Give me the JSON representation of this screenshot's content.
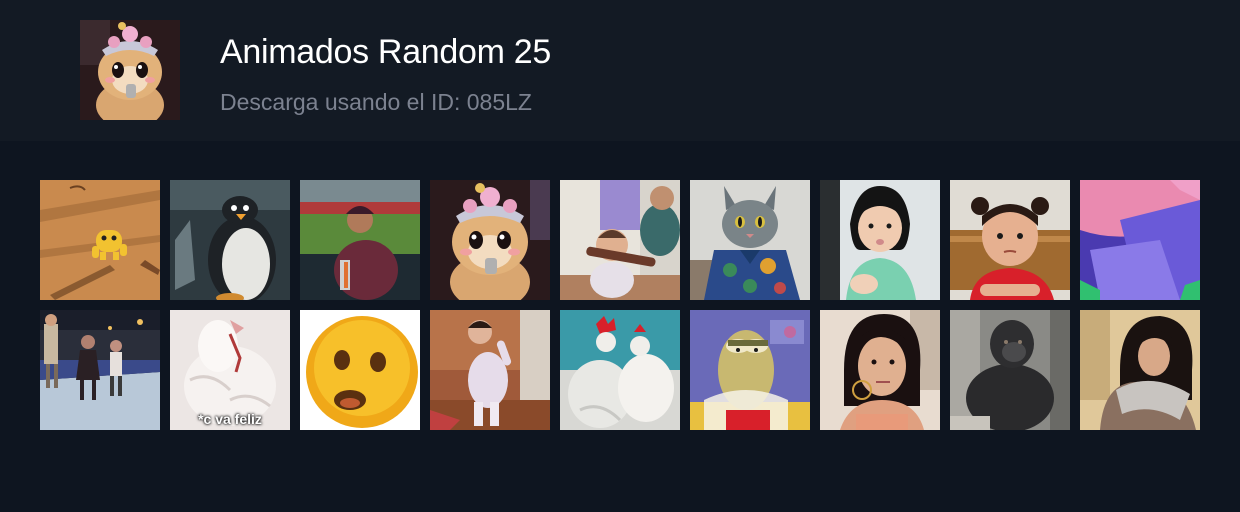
{
  "pack": {
    "title": "Animados Random 25",
    "subtitle": "Descarga usando el ID: 085LZ",
    "avatar_icon": "hamster-mascot-sticker"
  },
  "stickers": [
    {
      "icon": "cartoon-dog-jumping"
    },
    {
      "icon": "penguin"
    },
    {
      "icon": "baseball-player"
    },
    {
      "icon": "hamster-mascot"
    },
    {
      "icon": "baby-with-toy"
    },
    {
      "icon": "cat-in-hawaiian-shirt"
    },
    {
      "icon": "little-girl"
    },
    {
      "icon": "toddler-girl-red-shirt"
    },
    {
      "icon": "abstract-colors"
    },
    {
      "icon": "people-skating"
    },
    {
      "icon": "white-chicken",
      "caption": "*c va feliz"
    },
    {
      "icon": "emoji-face-surprised"
    },
    {
      "icon": "toddler-dancing"
    },
    {
      "icon": "roosters"
    },
    {
      "icon": "cartoon-fish"
    },
    {
      "icon": "woman-side-eye"
    },
    {
      "icon": "gorilla"
    },
    {
      "icon": "woman-with-scarf"
    }
  ]
}
